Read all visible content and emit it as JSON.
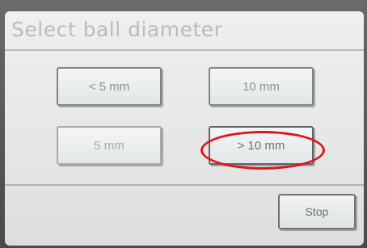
{
  "screen": {
    "title": "Select ball diameter"
  },
  "options": {
    "lt5": "< 5 mm",
    "mm10": "10 mm",
    "mm5": "5 mm",
    "gt10": "> 10 mm"
  },
  "actions": {
    "stop_label": "Stop"
  },
  "annotation": {
    "highlight_color": "#e0141c",
    "highlighted_option": "> 10 mm"
  },
  "colors": {
    "screen_bg": "#e9ebeb",
    "button_border": "#7f8383",
    "text": "#8e9292"
  }
}
